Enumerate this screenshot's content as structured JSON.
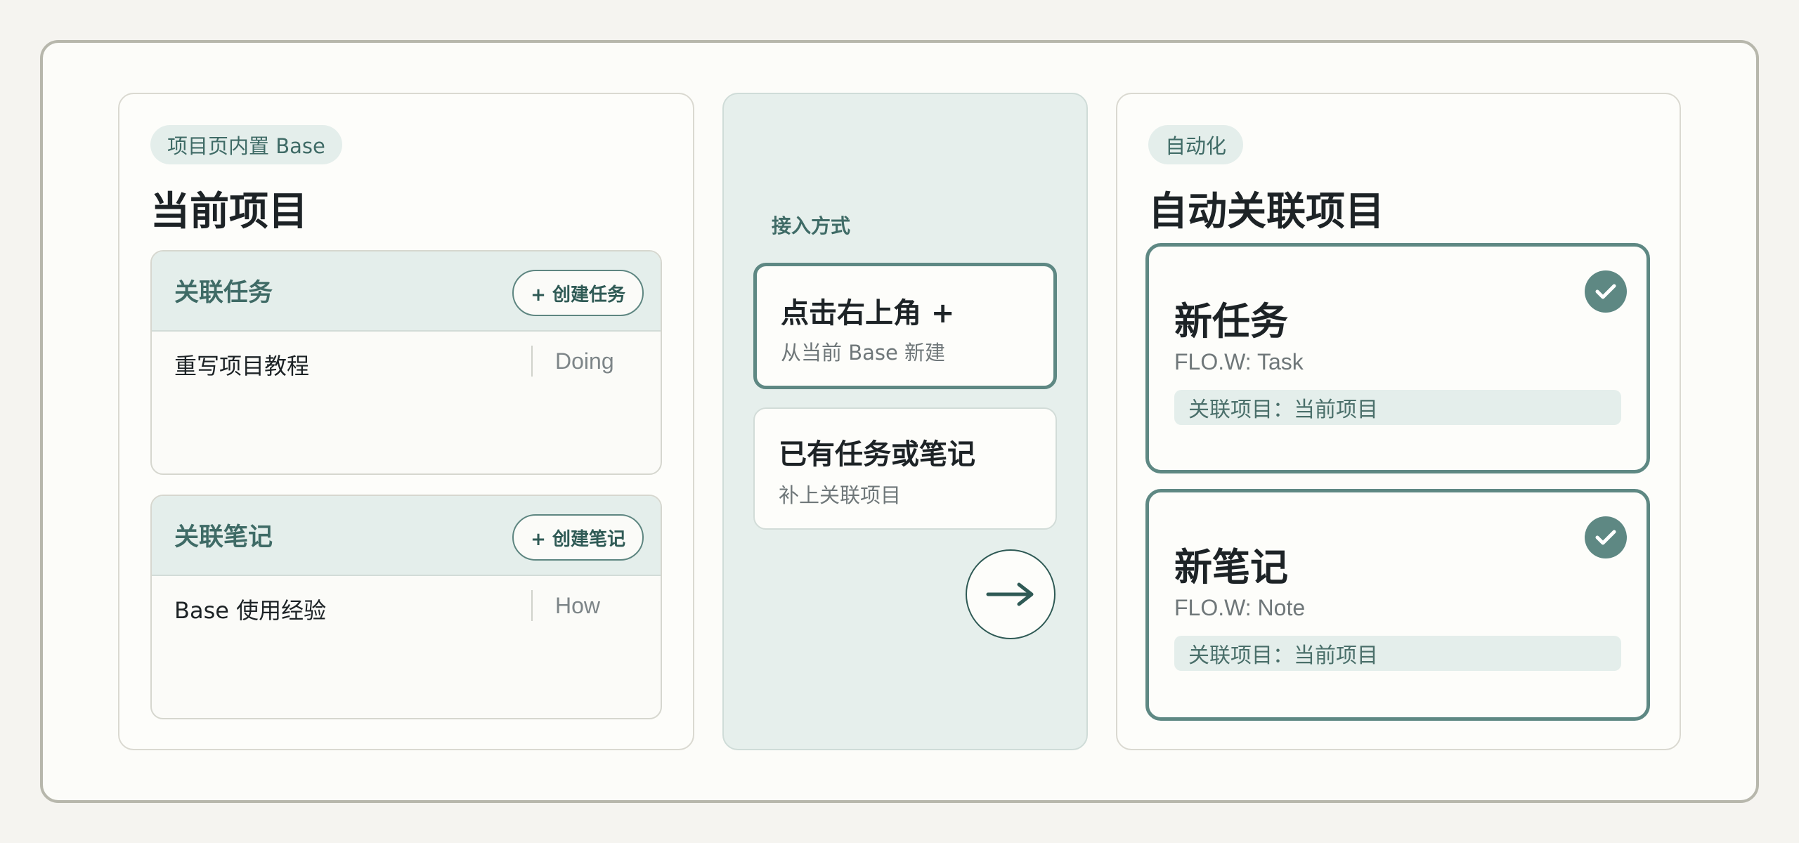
{
  "left": {
    "pill": "项目页内置 Base",
    "title": "当前项目",
    "tasks_card": {
      "title": "关联任务",
      "button": "+ 创建任务",
      "rows": [
        {
          "title": "重写项目教程",
          "status": "Doing"
        }
      ]
    },
    "notes_card": {
      "title": "关联笔记",
      "button": "+ 创建笔记",
      "rows": [
        {
          "title": "Base 使用经验",
          "status": "How"
        }
      ]
    }
  },
  "middle": {
    "label": "接入方式",
    "options": [
      {
        "title": "点击右上角 +",
        "subtitle": "从当前 Base 新建"
      },
      {
        "title": "已有任务或笔记",
        "subtitle": "补上关联项目"
      }
    ],
    "arrow_icon": "arrow-right-icon"
  },
  "right": {
    "pill": "自动化",
    "title": "自动关联项目",
    "cards": [
      {
        "title": "新任务",
        "subtitle": "FLO.W: Task",
        "tag": "关联项目：当前项目"
      },
      {
        "title": "新笔记",
        "subtitle": "FLO.W: Note",
        "tag": "关联项目：当前项目"
      }
    ],
    "check_icon": "check-icon"
  },
  "colors": {
    "accent": "#5e8883",
    "accent_dark": "#3f6b66",
    "tint": "#e4eeeb",
    "background": "#f5f4f0"
  }
}
